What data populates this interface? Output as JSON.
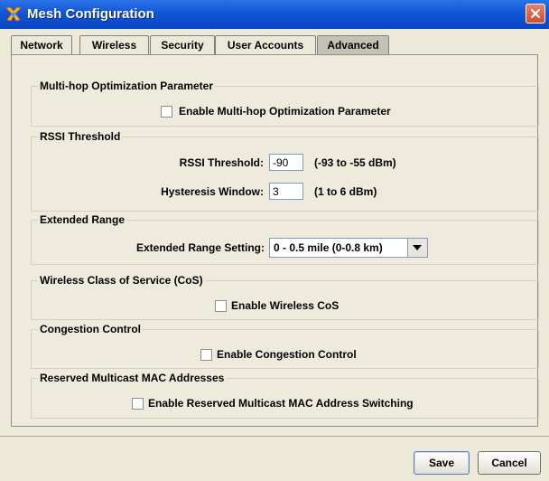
{
  "window": {
    "title": "Mesh Configuration"
  },
  "tabs": [
    {
      "label": "Network",
      "active": false
    },
    {
      "label": "Wireless",
      "active": false
    },
    {
      "label": "Security",
      "active": false
    },
    {
      "label": "User Accounts",
      "active": false
    },
    {
      "label": "Advanced",
      "active": true
    }
  ],
  "multihop": {
    "legend": "Multi-hop Optimization Parameter",
    "checkbox_label": "Enable Multi-hop Optimization Parameter",
    "checked": false
  },
  "rssi": {
    "legend": "RSSI Threshold",
    "threshold_label": "RSSI Threshold:",
    "threshold_value": "-90",
    "threshold_hint": "(-93 to -55 dBm)",
    "hysteresis_label": "Hysteresis Window:",
    "hysteresis_value": "3",
    "hysteresis_hint": "(1 to 6 dBm)"
  },
  "extended_range": {
    "legend": "Extended Range",
    "setting_label": "Extended Range Setting:",
    "selected": "0 - 0.5 mile (0-0.8 km)"
  },
  "cos": {
    "legend": "Wireless Class of Service (CoS)",
    "checkbox_label": "Enable Wireless CoS",
    "checked": false
  },
  "congestion": {
    "legend": "Congestion Control",
    "checkbox_label": "Enable Congestion Control",
    "checked": false
  },
  "multicast": {
    "legend": "Reserved Multicast MAC Addresses",
    "checkbox_label": "Enable Reserved Multicast MAC Address Switching",
    "checked": false
  },
  "buttons": {
    "save": "Save",
    "cancel": "Cancel"
  },
  "colors": {
    "titlebar": "#1255d6",
    "close": "#d24a2a",
    "active_tab": "#c4c1b5"
  }
}
